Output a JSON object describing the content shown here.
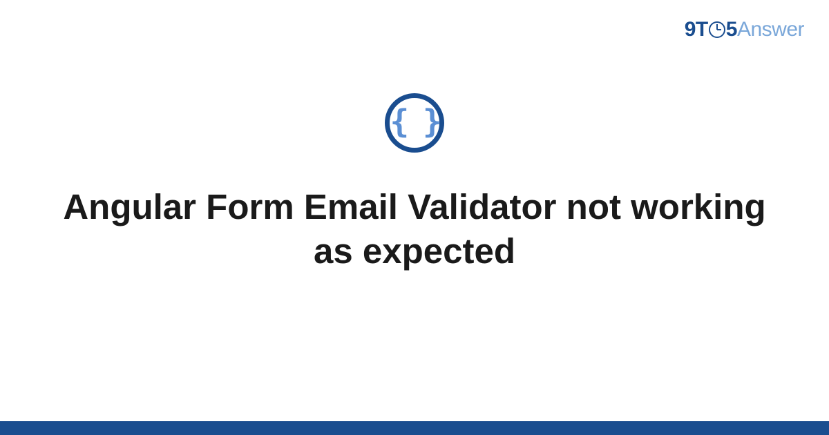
{
  "brand": {
    "part1": "9T",
    "part2": "5",
    "part3": "Answer"
  },
  "icon": {
    "glyph": "{ }"
  },
  "title": "Angular Form Email Validator not working as expected"
}
